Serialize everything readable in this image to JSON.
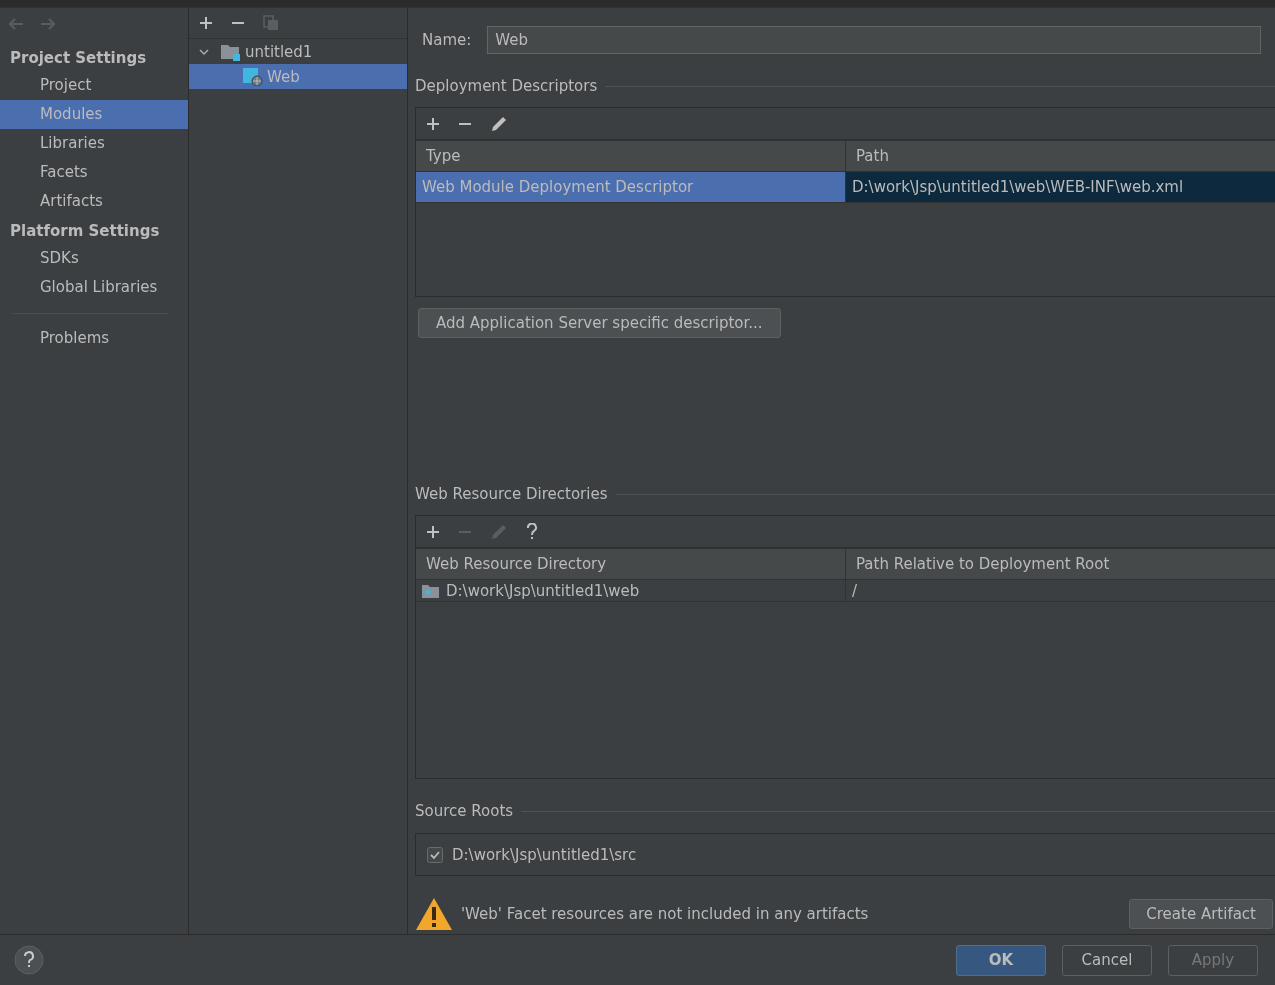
{
  "sidebar": {
    "sections": [
      {
        "title": "Project Settings",
        "items": [
          {
            "label": "Project",
            "selected": false
          },
          {
            "label": "Modules",
            "selected": true
          },
          {
            "label": "Libraries",
            "selected": false
          },
          {
            "label": "Facets",
            "selected": false
          },
          {
            "label": "Artifacts",
            "selected": false
          }
        ]
      },
      {
        "title": "Platform Settings",
        "items": [
          {
            "label": "SDKs",
            "selected": false
          },
          {
            "label": "Global Libraries",
            "selected": false
          }
        ]
      }
    ],
    "extra_items": [
      {
        "label": "Problems",
        "selected": false
      }
    ]
  },
  "module_tree": {
    "tools": [
      {
        "kind": "add",
        "disabled": false
      },
      {
        "kind": "remove",
        "disabled": false
      },
      {
        "kind": "copy",
        "disabled": true
      }
    ],
    "items": [
      {
        "label": "untitled1",
        "expanded": true,
        "selected": false,
        "children": [
          {
            "label": "Web",
            "selected": true
          }
        ]
      }
    ]
  },
  "name_field": {
    "label": "Name:",
    "value": "Web"
  },
  "deployment_descriptors": {
    "title": "Deployment Descriptors",
    "tools": [
      {
        "kind": "add",
        "disabled": false
      },
      {
        "kind": "remove",
        "disabled": false
      },
      {
        "kind": "edit",
        "disabled": false
      }
    ],
    "columns": [
      "Type",
      "Path"
    ],
    "rows": [
      {
        "cells": [
          "Web Module Deployment Descriptor",
          "D:\\work\\Jsp\\untitled1\\web\\WEB-INF\\web.xml"
        ],
        "selected": true
      }
    ],
    "add_button": "Add Application Server specific descriptor..."
  },
  "web_resource_directories": {
    "title": "Web Resource Directories",
    "tools": [
      {
        "kind": "add",
        "disabled": false
      },
      {
        "kind": "remove",
        "disabled": true
      },
      {
        "kind": "edit",
        "disabled": true
      },
      {
        "kind": "help",
        "disabled": false
      }
    ],
    "columns": [
      "Web Resource Directory",
      "Path Relative to Deployment Root"
    ],
    "rows": [
      {
        "cells": [
          "D:\\work\\Jsp\\untitled1\\web",
          "/"
        ],
        "selected": false
      }
    ]
  },
  "source_roots": {
    "title": "Source Roots",
    "items": [
      {
        "path": "D:\\work\\Jsp\\untitled1\\src",
        "checked": true
      }
    ]
  },
  "warning": {
    "text": "'Web' Facet resources are not included in any artifacts",
    "button": "Create Artifact"
  },
  "footer": {
    "buttons": [
      {
        "label": "OK",
        "kind": "default"
      },
      {
        "label": "Cancel",
        "kind": "normal"
      },
      {
        "label": "Apply",
        "kind": "disabled"
      }
    ]
  }
}
